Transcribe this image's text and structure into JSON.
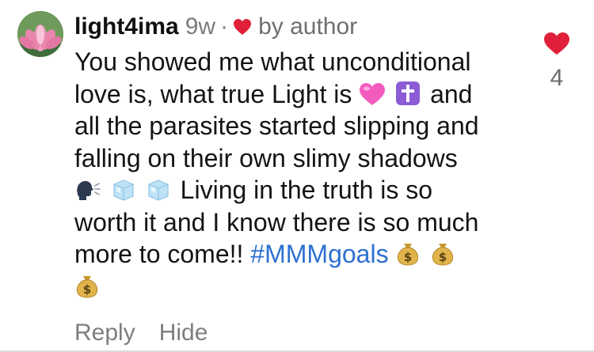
{
  "comment": {
    "username": "light4ima",
    "time": "9w",
    "separator": "·",
    "author_label": "by author",
    "lines": [
      "You showed me what unconditional",
      "love is, what true Light is",
      "and",
      "all the parasites started slipping and",
      "falling on their own slimy shadows",
      "Living in the truth is so",
      "worth it and I know there is so much",
      "more to come!!",
      "#MMMgoals"
    ],
    "actions": {
      "reply": "Reply",
      "hide": "Hide"
    },
    "likes": "4"
  },
  "icons": {
    "avatar": "lotus-flower-avatar",
    "author_like": "heart-icon",
    "like": "heart-icon",
    "emoji_heart": "pink-heart-emoji",
    "emoji_cross": "latin-cross-emoji",
    "emoji_speaker": "speaking-head-emoji",
    "emoji_ice": "ice-cube-emoji",
    "emoji_money": "money-bag-emoji"
  },
  "colors": {
    "heart": "#e0203b",
    "hashtag": "#2d6fd1",
    "muted": "#7c7c7c"
  }
}
